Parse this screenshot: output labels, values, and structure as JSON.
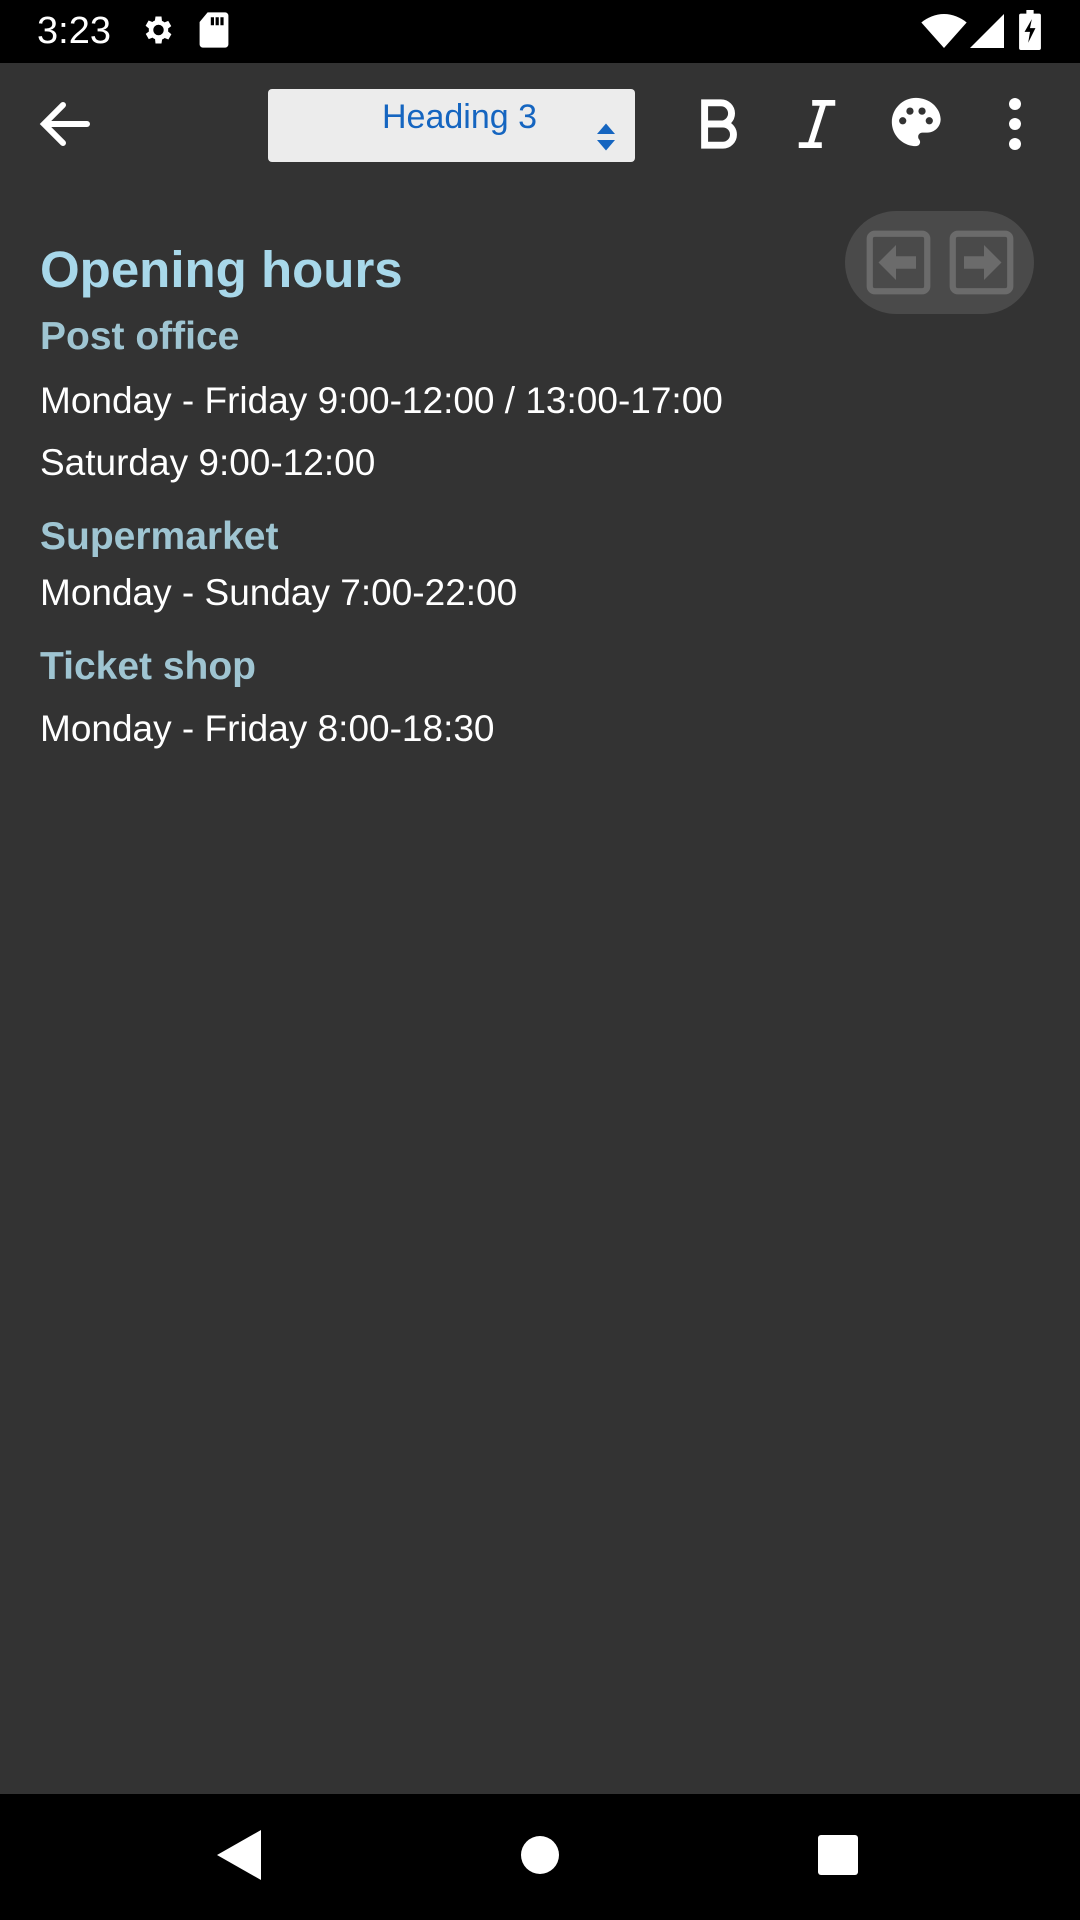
{
  "status_bar": {
    "time": "3:23",
    "icons_left": [
      "gear-icon",
      "sd-card-icon"
    ],
    "icons_right": [
      "wifi-icon",
      "signal-icon",
      "battery-charging-icon"
    ]
  },
  "toolbar": {
    "back_icon": "arrow-left-icon",
    "style_select": {
      "value": "Heading 3"
    },
    "bold_icon": "bold-icon",
    "italic_icon": "italic-icon",
    "color_icon": "palette-icon",
    "more_icon": "more-vert-icon"
  },
  "document": {
    "title": "Opening hours",
    "sections": [
      {
        "heading": "Post office",
        "lines": [
          "Monday - Friday 9:00-12:00 / 13:00-17:00",
          "Saturday 9:00-12:00"
        ]
      },
      {
        "heading": "Supermarket",
        "lines": [
          "Monday - Sunday 7:00-22:00"
        ]
      },
      {
        "heading": "Ticket shop",
        "lines": [
          "Monday - Friday 8:00-18:30"
        ]
      }
    ]
  },
  "pager": {
    "prev_icon": "arrow-left-box-icon",
    "next_icon": "arrow-right-box-icon"
  },
  "nav_bar": {
    "icons": [
      "back-triangle-icon",
      "home-circle-icon",
      "recents-square-icon"
    ]
  },
  "colors": {
    "background": "#333333",
    "title": "#a8d8ea",
    "heading": "#9fc5d2",
    "body_text": "#ffffff",
    "select_text": "#1565c0"
  }
}
